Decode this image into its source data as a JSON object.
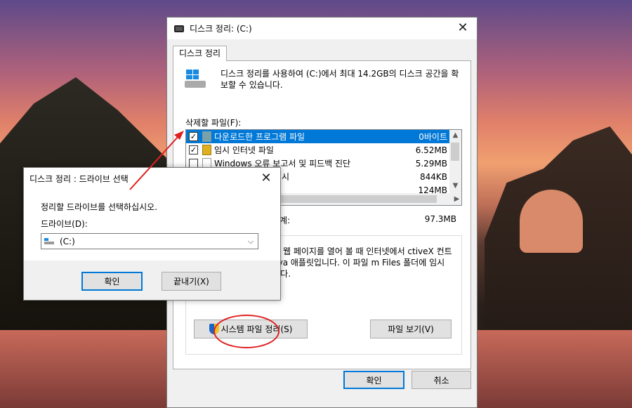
{
  "main_window": {
    "title": "디스크 정리: (C:)",
    "tab": "디스크 정리",
    "description": "디스크 정리를 사용하여 (C:)에서 최대 14.2GB의 디스크 공간을 확보할 수 있습니다.",
    "files_label": "삭제할 파일(F):",
    "files": [
      {
        "name": "다운로드한 프로그램 파일",
        "size": "0바이트",
        "checked": true,
        "selected": true
      },
      {
        "name": "임시 인터넷 파일",
        "size": "6.52MB",
        "checked": true,
        "selected": false
      },
      {
        "name": "Windows 오류 보고서 및 피드백 진단",
        "size": "5.29MB",
        "checked": false,
        "selected": false
      },
      {
        "name": "DirectX 셰이더 캐시",
        "size": "844KB",
        "checked": false,
        "selected": false
      },
      {
        "name": "",
        "size": "124MB",
        "checked": false,
        "selected": false
      }
    ],
    "total_label": "합계:",
    "total_value": "97.3MB",
    "description_text": "파일이란 웹 페이지를 열어 볼 때 인터넷에서 ctiveX 컨트롤 및 Java 애플릿입니다. 이 파일 m Files 폴더에 임시 저장됩니다.",
    "system_clean_button": "시스템 파일 정리(S)",
    "view_files_button": "파일 보기(V)",
    "ok_button": "확인",
    "cancel_button": "취소"
  },
  "drive_dialog": {
    "title": "디스크 정리 : 드라이브 선택",
    "prompt": "정리할 드라이브를 선택하십시오.",
    "drive_label": "드라이브(D):",
    "drive_value": "(C:)",
    "ok_button": "확인",
    "exit_button": "끝내기(X)"
  },
  "annotation_color": "#e02020"
}
